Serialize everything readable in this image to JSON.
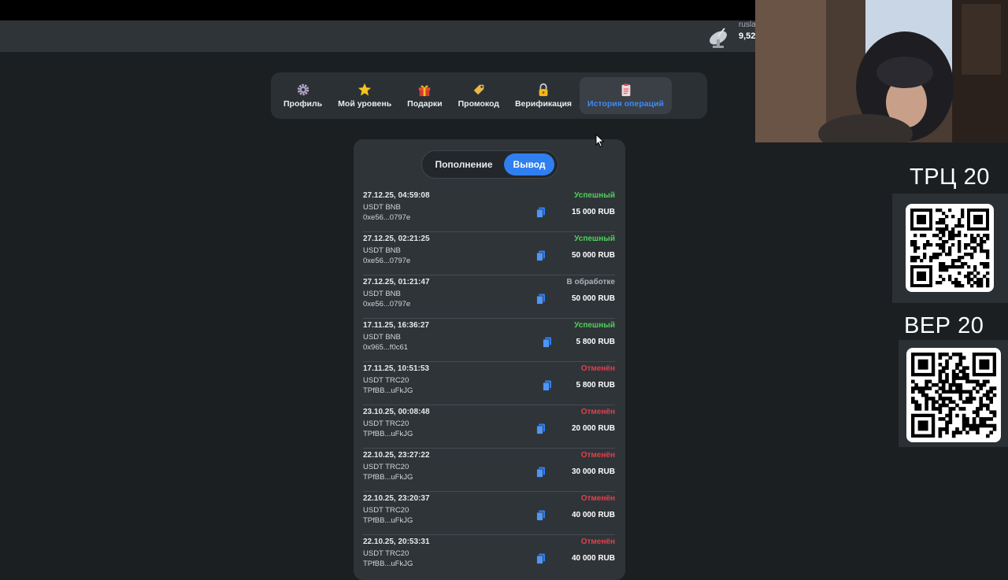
{
  "header": {
    "user_name": "rusla",
    "user_balance": "9,52"
  },
  "nav": {
    "items": [
      {
        "label": "Профиль",
        "icon": "gear-icon"
      },
      {
        "label": "Мой уровень",
        "icon": "star-icon"
      },
      {
        "label": "Подарки",
        "icon": "gift-icon"
      },
      {
        "label": "Промокод",
        "icon": "tag-icon"
      },
      {
        "label": "Верификация",
        "icon": "lock-icon"
      },
      {
        "label": "История операций",
        "icon": "clipboard-icon"
      }
    ]
  },
  "toggle": {
    "deposit": "Пополнение",
    "withdraw": "Вывод"
  },
  "operations": [
    {
      "date": "27.12.25, 04:59:08",
      "coin": "USDT BNB",
      "address": "0xe56...0797e",
      "status": "Успешный",
      "amount": "15 000 RUB"
    },
    {
      "date": "27.12.25, 02:21:25",
      "coin": "USDT BNB",
      "address": "0xe56...0797e",
      "status": "Успешный",
      "amount": "50 000 RUB"
    },
    {
      "date": "27.12.25, 01:21:47",
      "coin": "USDT BNB",
      "address": "0xe56...0797e",
      "status": "В обработке",
      "amount": "50 000 RUB"
    },
    {
      "date": "17.11.25, 16:36:27",
      "coin": "USDT BNB",
      "address": "0x965...f0c61",
      "status": "Успешный",
      "amount": "5 800 RUB"
    },
    {
      "date": "17.11.25, 10:51:53",
      "coin": "USDT TRC20",
      "address": "TPfBB...uFkJG",
      "status": "Отменён",
      "amount": "5 800 RUB"
    },
    {
      "date": "23.10.25, 00:08:48",
      "coin": "USDT TRC20",
      "address": "TPfBB...uFkJG",
      "status": "Отменён",
      "amount": "20 000 RUB"
    },
    {
      "date": "22.10.25, 23:27:22",
      "coin": "USDT TRC20",
      "address": "TPfBB...uFkJG",
      "status": "Отменён",
      "amount": "30 000 RUB"
    },
    {
      "date": "22.10.25, 23:20:37",
      "coin": "USDT TRC20",
      "address": "TPfBB...uFkJG",
      "status": "Отменён",
      "amount": "40 000 RUB"
    },
    {
      "date": "22.10.25, 20:53:31",
      "coin": "USDT TRC20",
      "address": "TPfBB...uFkJG",
      "status": "Отменён",
      "amount": "40 000 RUB"
    }
  ],
  "promo": {
    "trc_label": "ТРЦ 20",
    "bep_label": "ВЕР 20"
  },
  "colors": {
    "accent": "#2f7ff0",
    "success": "#4fd15a",
    "cancelled": "#e0404b",
    "processing": "#aab0b6"
  }
}
